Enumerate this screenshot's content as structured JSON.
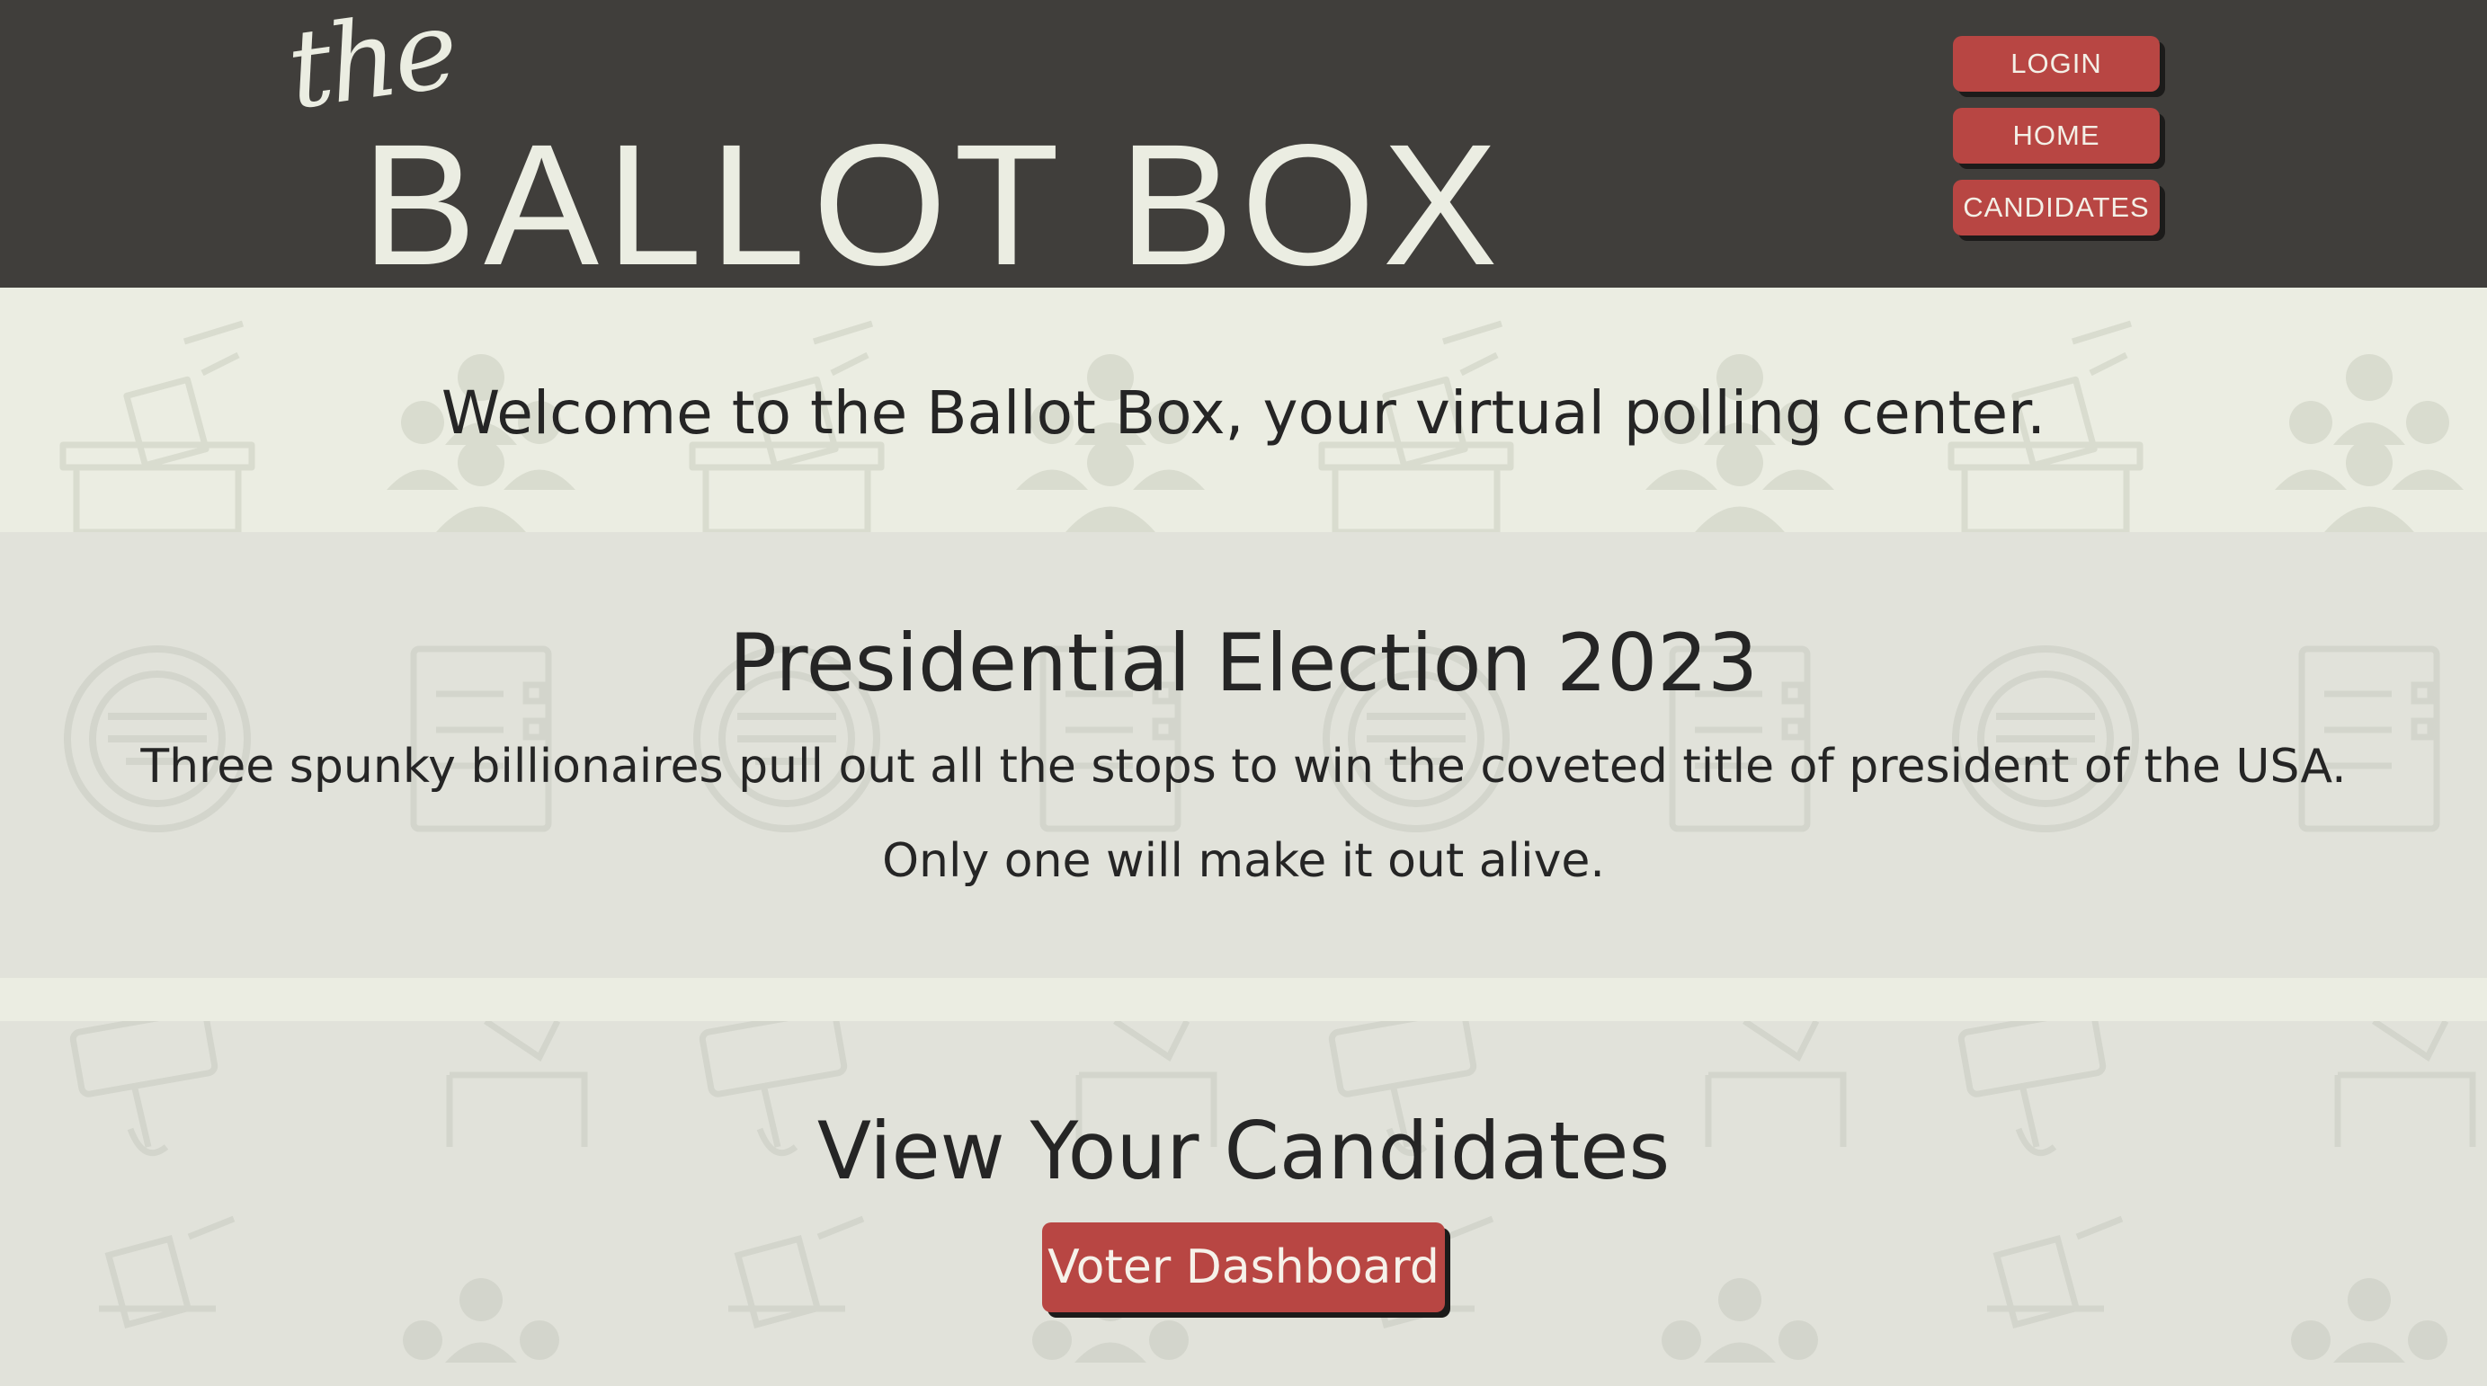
{
  "header": {
    "logo_small": "the",
    "logo_main": "BALLOT BOX",
    "nav": [
      {
        "label": "LOGIN"
      },
      {
        "label": "HOME"
      },
      {
        "label": "CANDIDATES"
      }
    ]
  },
  "welcome": {
    "text": "Welcome to the Ballot Box, your virtual polling center."
  },
  "election": {
    "title": "Presidential Election 2023",
    "description": "Three spunky billionaires pull out all the stops to win the coveted title of president of the USA.",
    "tagline": "Only one will make it out alive."
  },
  "candidates": {
    "title": "View Your Candidates",
    "button_label": "Voter Dashboard"
  },
  "pattern": {
    "ballot_box_icon": "ballot-box-icon",
    "crowd_icon": "crowd-icon",
    "vote_seal_icon": "vote-seal-icon",
    "ballot_sheet_icon": "ballot-sheet-icon",
    "vote_sign_icon": "vote-sign-icon"
  },
  "colors": {
    "header_bg": "#403e3b",
    "accent": "#b84643",
    "page_bg": "#ebede2",
    "band_bg": "#e1e2da",
    "text": "#252525"
  }
}
